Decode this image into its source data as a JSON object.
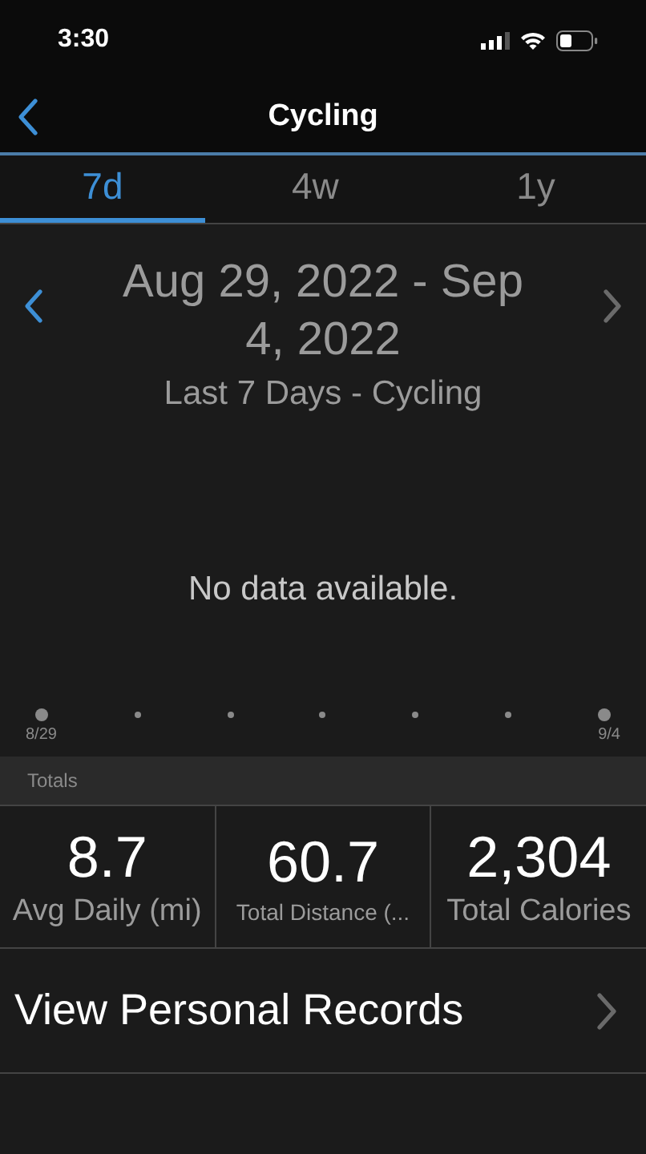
{
  "status_bar": {
    "time": "3:30"
  },
  "nav": {
    "title": "Cycling"
  },
  "tabs": [
    {
      "label": "7d",
      "selected": true
    },
    {
      "label": "4w",
      "selected": false
    },
    {
      "label": "1y",
      "selected": false
    }
  ],
  "period": {
    "range": "Aug 29, 2022 - Sep 4, 2022",
    "subtitle": "Last 7 Days - Cycling"
  },
  "chart": {
    "message": "No data available.",
    "start_label": "8/29",
    "end_label": "9/4"
  },
  "totals": {
    "header": "Totals",
    "stats": [
      {
        "value": "8.7",
        "label": "Avg Daily (mi)",
        "small": false
      },
      {
        "value": "60.7",
        "label": "Total Distance (...",
        "small": true
      },
      {
        "value": "2,304",
        "label": "Total Calories",
        "small": false
      }
    ]
  },
  "records": {
    "label": "View Personal Records"
  }
}
